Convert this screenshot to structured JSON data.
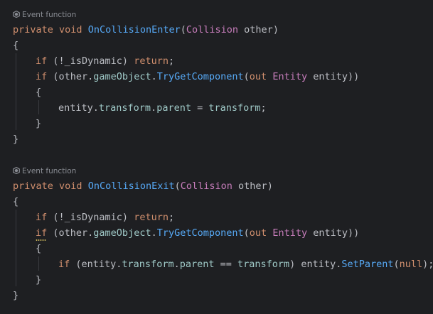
{
  "editor": {
    "language": "csharp",
    "colors": {
      "background": "#1e1f22",
      "text": "#bcbec4",
      "keyword": "#cf8e6d",
      "method": "#56a8f5",
      "type": "#c77dbb",
      "member": "#9fc9c7",
      "hint": "#8a8d94"
    }
  },
  "block1": {
    "hint": "Event function",
    "hint_icon": "unity-icon",
    "sig": {
      "private": "private",
      "void": "void",
      "name": "OnCollisionEnter",
      "open": "(",
      "type": "Collision",
      "param": " other)"
    },
    "open_brace": "{",
    "l1": {
      "if": "if",
      "cond_a": " (!_isDynamic) ",
      "ret": "return",
      "semi": ";"
    },
    "l2": {
      "if": "if",
      "a": " (other.",
      "go": "gameObject",
      "dot": ".",
      "tgc": "TryGetComponent",
      "p": "(",
      "out": "out",
      "sp": " ",
      "ent": "Entity",
      "rest": " entity))"
    },
    "inner_open": "{",
    "l3": {
      "a": "entity.",
      "tr": "transform",
      "dot": ".",
      "parent": "parent",
      "eq": " = ",
      "tr2": "transform",
      "semi": ";"
    },
    "inner_close": "}",
    "close_brace": "}"
  },
  "block2": {
    "hint": "Event function",
    "hint_icon": "unity-icon",
    "sig": {
      "private": "private",
      "void": "void",
      "name": "OnCollisionExit",
      "open": "(",
      "type": "Collision",
      "param": " other)"
    },
    "open_brace": "{",
    "l1": {
      "if": "if",
      "cond_a": " (!_isDynamic) ",
      "ret": "return",
      "semi": ";"
    },
    "l2": {
      "if": "if",
      "a": " (other.",
      "go": "gameObject",
      "dot": ".",
      "tgc": "TryGetComponent",
      "p": "(",
      "out": "out",
      "sp": " ",
      "ent": "Entity",
      "rest": " entity))"
    },
    "inner_open": "{",
    "l3": {
      "if": "if",
      "a": " (entity.",
      "tr": "transform",
      "dot": ".",
      "parent": "parent",
      "eq": " == ",
      "tr2": "transform",
      "b": ") entity.",
      "sp": "SetParent",
      "c": "(",
      "nul": "null",
      "d": ");"
    },
    "inner_close": "}",
    "close_brace": "}"
  }
}
